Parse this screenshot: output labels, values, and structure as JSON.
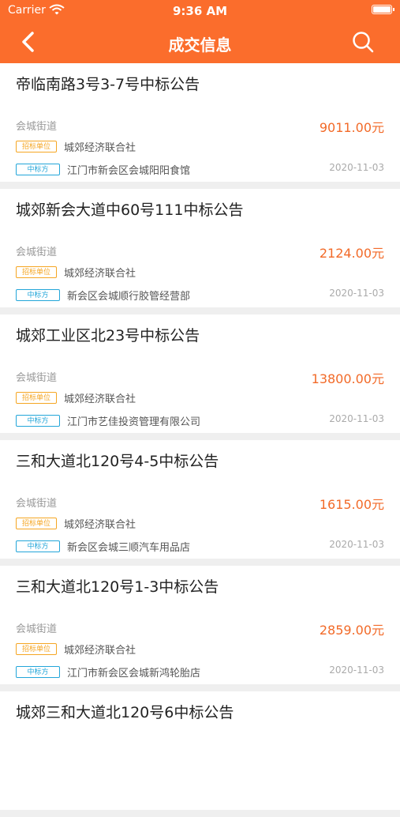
{
  "status_bar": {
    "carrier": "Carrier",
    "time": "9:36 AM"
  },
  "nav": {
    "title": "成交信息",
    "back_icon": "chevron-left-icon",
    "search_icon": "search-icon"
  },
  "colors": {
    "accent": "#fb6d2c",
    "amount": "#f26a28",
    "bid_tag": "#f5a623",
    "win_tag": "#23a6d9"
  },
  "labels": {
    "bid_unit": "招标单位",
    "winner": "中标方"
  },
  "items": [
    {
      "title": "帝临南路3号3-7号中标公告",
      "street": "会城街道",
      "amount": "9011.00元",
      "bid_unit": "城郊经济联合社",
      "winner": "江门市新会区会城阳阳食馆",
      "date": "2020-11-03"
    },
    {
      "title": "城郊新会大道中60号111中标公告",
      "street": "会城街道",
      "amount": "2124.00元",
      "bid_unit": "城郊经济联合社",
      "winner": "新会区会城顺行胶管经营部",
      "date": "2020-11-03"
    },
    {
      "title": "城郊工业区北23号中标公告",
      "street": "会城街道",
      "amount": "13800.00元",
      "bid_unit": "城郊经济联合社",
      "winner": "江门市艺佳投资管理有限公司",
      "date": "2020-11-03"
    },
    {
      "title": "三和大道北120号4-5中标公告",
      "street": "会城街道",
      "amount": "1615.00元",
      "bid_unit": "城郊经济联合社",
      "winner": "新会区会城三顺汽车用品店",
      "date": "2020-11-03"
    },
    {
      "title": "三和大道北120号1-3中标公告",
      "street": "会城街道",
      "amount": "2859.00元",
      "bid_unit": "城郊经济联合社",
      "winner": "江门市新会区会城新鸿轮胎店",
      "date": "2020-11-03"
    },
    {
      "title": "城郊三和大道北120号6中标公告",
      "street": "",
      "amount": "",
      "bid_unit": "",
      "winner": "",
      "date": ""
    }
  ]
}
